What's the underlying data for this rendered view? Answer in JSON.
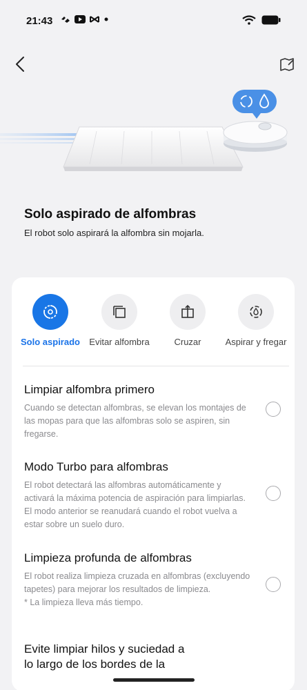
{
  "status_bar": {
    "time": "21:43",
    "left_icons": [
      "capcut-icon",
      "youtube-icon",
      "capcut-edit-icon",
      "dot-icon"
    ],
    "right_icons": [
      "wifi-icon",
      "battery-icon"
    ]
  },
  "nav": {
    "back_icon": "chevron-left-icon",
    "map_icon": "map-edit-icon"
  },
  "hero": {
    "bubble_icons": [
      "vacuum-swirl-icon",
      "water-drop-icon"
    ]
  },
  "header": {
    "title": "Solo aspirado de alfombras",
    "subtitle": "El robot solo aspirará la alfombra sin mojarla."
  },
  "modes": [
    {
      "label": "Solo aspirado",
      "icon": "swirl-icon",
      "active": true
    },
    {
      "label": "Evitar alfombra",
      "icon": "carpet-avoid-icon",
      "active": false
    },
    {
      "label": "Cruzar",
      "icon": "cross-icon",
      "active": false
    },
    {
      "label": "Aspirar y fregar",
      "icon": "vacuum-mop-icon",
      "active": false
    }
  ],
  "options": [
    {
      "title": "Limpiar alfombra primero",
      "desc": "Cuando se detectan alfombras, se elevan los montajes de las mopas para que las alfombras solo se aspiren, sin fregarse."
    },
    {
      "title": "Modo Turbo para alfombras",
      "desc": "El robot detectará las alfombras automáticamente y activará la máxima potencia de aspiración para limpiarlas. El modo anterior se reanudará cuando el robot vuelva a estar sobre un suelo duro."
    },
    {
      "title": "Limpieza profunda de alfombras",
      "desc": "El robot realiza limpieza cruzada en alfombras (excluyendo tapetes) para mejorar los resultados de limpieza.",
      "note": "* La limpieza lleva más tiempo."
    },
    {
      "title": "Evite limpiar hilos y suciedad a lo largo de los bordes de la"
    }
  ],
  "colors": {
    "accent": "#1976e6",
    "background": "#f2f2f4",
    "card": "#ffffff"
  }
}
